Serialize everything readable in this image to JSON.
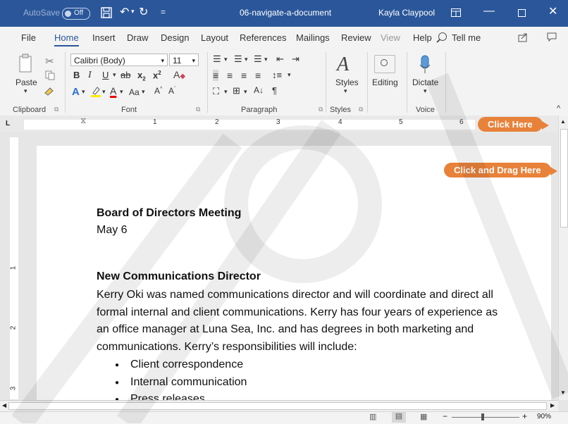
{
  "title_bar": {
    "autosave_label": "AutoSave",
    "autosave_state": "Off",
    "document_title": "06-navigate-a-document",
    "user_name": "Kayla Claypool"
  },
  "ribbon_tabs": [
    "File",
    "Home",
    "Insert",
    "Draw",
    "Design",
    "Layout",
    "References",
    "Mailings",
    "Review",
    "View",
    "Help"
  ],
  "active_tab": "Home",
  "tell_me": "Tell me",
  "clipboard": {
    "paste_label": "Paste",
    "group_label": "Clipboard"
  },
  "font": {
    "font_name": "Calibri (Body)",
    "font_size": "11",
    "change_case": "Aa",
    "group_label": "Font"
  },
  "paragraph": {
    "group_label": "Paragraph",
    "pilcrow": "¶"
  },
  "styles": {
    "button_label": "Styles",
    "group_label": "Styles"
  },
  "editing": {
    "button_label": "Editing"
  },
  "voice": {
    "button_label": "Dictate",
    "group_label": "Voice"
  },
  "ruler": {
    "numbers": [
      "1",
      "2",
      "3",
      "4",
      "5",
      "6"
    ]
  },
  "vruler": {
    "numbers": [
      "1",
      "2",
      "3"
    ]
  },
  "document": {
    "heading1": "Board of Directors Meeting",
    "date": "May 6",
    "heading2": "New Communications Director",
    "paragraph_lines": [
      "Kerry Oki was named communications director and will coordinate and direct all",
      "formal internal and client communications. Kerry has four years of experience as",
      "an office manager at Luna Sea, Inc. and has degrees in both marketing and",
      "communications. Kerry’s responsibilities will include:"
    ],
    "bullets": [
      "Client correspondence",
      "Internal communication",
      "Press releases"
    ]
  },
  "callouts": {
    "top": "Click Here",
    "drag": "Click and Drag Here"
  },
  "status_bar": {
    "zoom": "90%"
  },
  "colors": {
    "word_blue": "#2b579a",
    "callout_orange": "#e8823a"
  }
}
